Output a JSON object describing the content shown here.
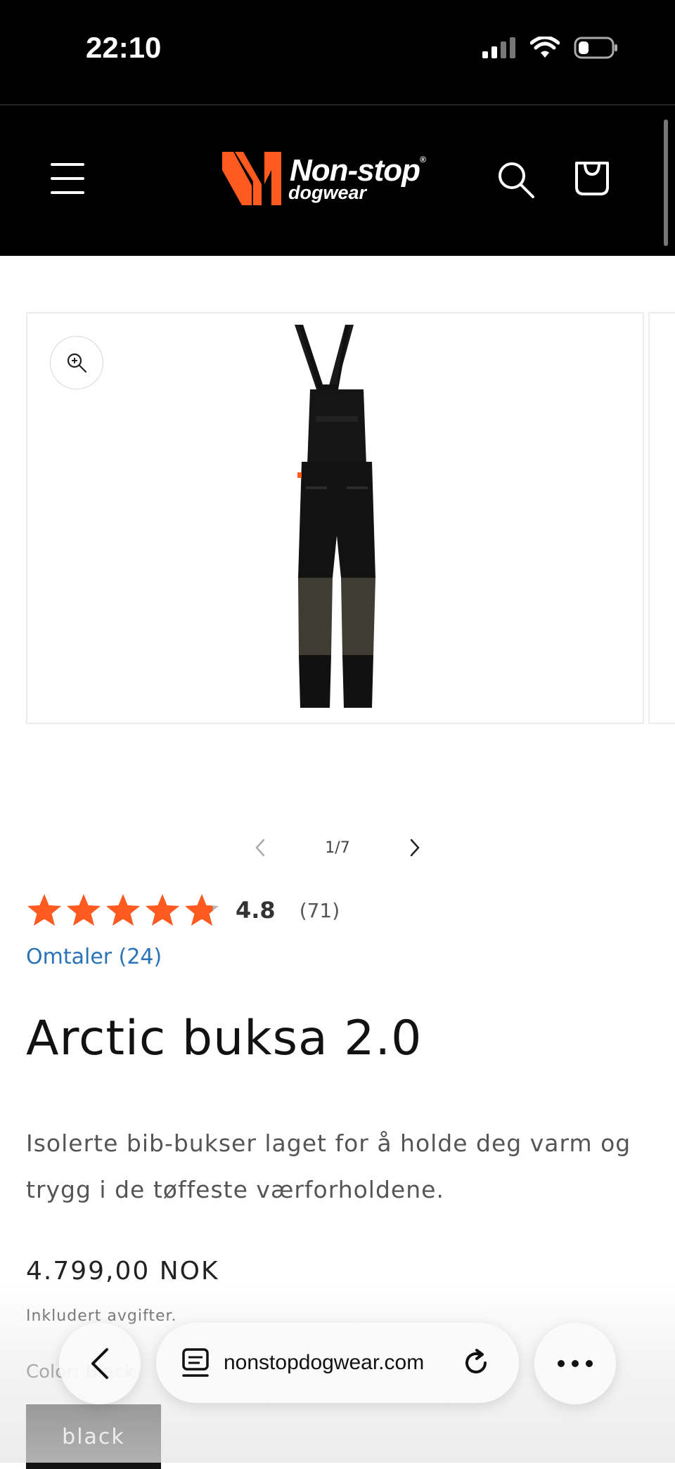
{
  "status_bar": {
    "time": "22:10"
  },
  "header": {
    "brand_main": "Non-stop",
    "brand_sub": "dogwear",
    "brand_color": "#ff5a1f"
  },
  "gallery": {
    "counter": "1/7"
  },
  "rating": {
    "score": "4.8",
    "count": "(71)",
    "stars_value": 4.8,
    "star_color": "#ff5a1f",
    "reviews_link": "Omtaler (24)"
  },
  "product": {
    "title": "Arctic buksa 2.0",
    "description": "Isolerte bib-bukser laget for å holde deg varm og trygg i de tøffeste værforholdene.",
    "price": "4.799,00 NOK",
    "tax_note": "Inkludert avgifter.",
    "color_label": "Color: Black",
    "variant_selected": "black"
  },
  "browser": {
    "url": "nonstopdogwear.com"
  },
  "icons": [
    "menu-icon",
    "search-icon",
    "cart-icon",
    "zoom-icon",
    "chevron-left-icon",
    "chevron-right-icon",
    "back-icon",
    "tabs-icon",
    "reload-icon",
    "more-icon"
  ]
}
